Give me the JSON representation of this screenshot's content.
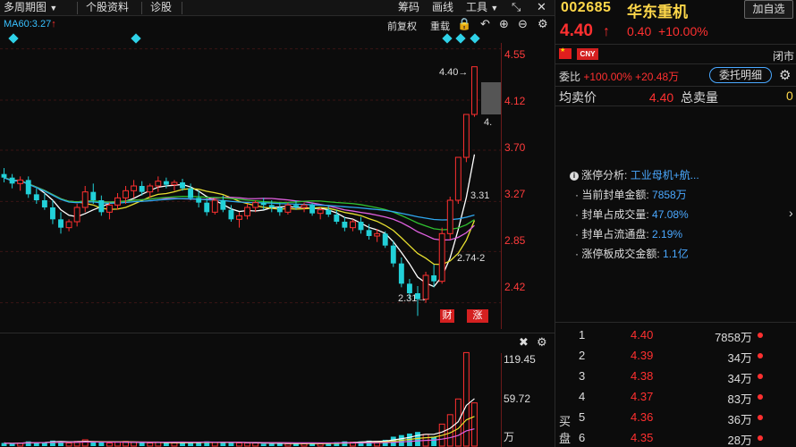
{
  "toolbar": {
    "period_label": "多周期图",
    "stock_info_label": "个股资料",
    "diagnose_label": "诊股",
    "chips_label": "筹码",
    "drawing_label": "画线",
    "tools_label": "工具"
  },
  "ma": {
    "label": "MA60:3.27",
    "arrow": "↑"
  },
  "chart_controls": {
    "forward_adj_label": "前复权",
    "overlay_label": "重载"
  },
  "price_axis": [
    "4.55",
    "4.12",
    "3.70",
    "3.27",
    "2.85",
    "2.42"
  ],
  "annotations": {
    "high": "4.40→",
    "low": "2.31→",
    "ma_val": "3.31",
    "ma_val2": "2.74-2",
    "ma_val3": "4.",
    "badge_cai": "财",
    "badge_zhang": "涨"
  },
  "volume_axis": [
    "119.45",
    "59.72",
    "万"
  ],
  "right_panel": {
    "code": "002685",
    "name": "华东重机",
    "add_watch_label": "加自选",
    "price": "4.40",
    "arrow": "↑",
    "change": "0.40",
    "change_pct": "+10.00%",
    "currency_badge": "CNY",
    "status": "闭市",
    "weibi_label": "委比",
    "weibi_value": "+100.00%",
    "weicha_value": "+20.48万",
    "detail_button": "委托明细",
    "avg_label": "均卖价",
    "avg_value": "4.40",
    "total_label": "总卖量",
    "total_value": "0",
    "limit_up": {
      "title": "涨停分析:",
      "sector": "工业母机+航...",
      "rows": [
        {
          "label": "当前封单金额:",
          "value": "7858万"
        },
        {
          "label": "封单占成交量:",
          "value": "47.08%"
        },
        {
          "label": "封单占流通盘:",
          "value": "2.19%"
        },
        {
          "label": "涨停板成交金额:",
          "value": "1.1亿"
        }
      ]
    },
    "buy_label": "买盘",
    "order_book": [
      {
        "idx": "1",
        "price": "4.40",
        "vol": "7858万"
      },
      {
        "idx": "2",
        "price": "4.39",
        "vol": "34万"
      },
      {
        "idx": "3",
        "price": "4.38",
        "vol": "34万"
      },
      {
        "idx": "4",
        "price": "4.37",
        "vol": "83万"
      },
      {
        "idx": "5",
        "price": "4.36",
        "vol": "36万"
      },
      {
        "idx": "6",
        "price": "4.35",
        "vol": "28万"
      }
    ]
  },
  "colors": {
    "up": "#ff3030",
    "down": "#22d0d8",
    "ma5": "#ffffff",
    "ma10": "#e8e030",
    "ma20": "#e060e0",
    "ma30": "#30c030",
    "ma60": "#2fa8f0"
  },
  "chart_data": {
    "type": "candlestick",
    "ylim": [
      2.2,
      4.6
    ],
    "ohlc": [
      [
        3.5,
        3.55,
        3.43,
        3.47
      ],
      [
        3.47,
        3.5,
        3.38,
        3.42
      ],
      [
        3.42,
        3.48,
        3.36,
        3.45
      ],
      [
        3.45,
        3.48,
        3.3,
        3.33
      ],
      [
        3.33,
        3.38,
        3.25,
        3.28
      ],
      [
        3.28,
        3.34,
        3.2,
        3.22
      ],
      [
        3.22,
        3.28,
        3.08,
        3.12
      ],
      [
        3.12,
        3.18,
        3.0,
        3.05
      ],
      [
        3.05,
        3.12,
        3.02,
        3.1
      ],
      [
        3.1,
        3.25,
        3.06,
        3.22
      ],
      [
        3.22,
        3.4,
        3.18,
        3.35
      ],
      [
        3.35,
        3.42,
        3.25,
        3.28
      ],
      [
        3.28,
        3.32,
        3.15,
        3.18
      ],
      [
        3.18,
        3.26,
        3.12,
        3.24
      ],
      [
        3.24,
        3.34,
        3.2,
        3.3
      ],
      [
        3.3,
        3.4,
        3.25,
        3.36
      ],
      [
        3.36,
        3.45,
        3.3,
        3.4
      ],
      [
        3.4,
        3.44,
        3.32,
        3.35
      ],
      [
        3.35,
        3.42,
        3.3,
        3.4
      ],
      [
        3.4,
        3.48,
        3.35,
        3.44
      ],
      [
        3.44,
        3.47,
        3.38,
        3.41
      ],
      [
        3.41,
        3.45,
        3.36,
        3.43
      ],
      [
        3.43,
        3.46,
        3.36,
        3.38
      ],
      [
        3.38,
        3.42,
        3.28,
        3.3
      ],
      [
        3.3,
        3.36,
        3.22,
        3.26
      ],
      [
        3.26,
        3.3,
        3.15,
        3.18
      ],
      [
        3.18,
        3.3,
        3.16,
        3.28
      ],
      [
        3.28,
        3.32,
        3.18,
        3.2
      ],
      [
        3.2,
        3.24,
        3.1,
        3.12
      ],
      [
        3.12,
        3.18,
        3.05,
        3.15
      ],
      [
        3.15,
        3.25,
        3.12,
        3.22
      ],
      [
        3.22,
        3.28,
        3.18,
        3.26
      ],
      [
        3.26,
        3.3,
        3.2,
        3.24
      ],
      [
        3.24,
        3.28,
        3.18,
        3.22
      ],
      [
        3.22,
        3.26,
        3.15,
        3.18
      ],
      [
        3.18,
        3.26,
        3.16,
        3.24
      ],
      [
        3.24,
        3.28,
        3.2,
        3.22
      ],
      [
        3.22,
        3.26,
        3.18,
        3.24
      ],
      [
        3.24,
        3.26,
        3.15,
        3.17
      ],
      [
        3.17,
        3.22,
        3.12,
        3.2
      ],
      [
        3.2,
        3.24,
        3.14,
        3.16
      ],
      [
        3.16,
        3.2,
        3.08,
        3.1
      ],
      [
        3.1,
        3.14,
        3.02,
        3.05
      ],
      [
        3.05,
        3.12,
        3.02,
        3.1
      ],
      [
        3.1,
        3.14,
        3.0,
        3.03
      ],
      [
        3.03,
        3.08,
        2.95,
        2.98
      ],
      [
        2.98,
        3.04,
        2.93,
        3.0
      ],
      [
        3.0,
        3.02,
        2.88,
        2.9
      ],
      [
        2.9,
        2.94,
        2.72,
        2.75
      ],
      [
        2.75,
        2.8,
        2.55,
        2.58
      ],
      [
        2.58,
        2.62,
        2.45,
        2.5
      ],
      [
        2.5,
        2.56,
        2.31,
        2.45
      ],
      [
        2.45,
        2.68,
        2.42,
        2.65
      ],
      [
        2.65,
        2.74,
        2.55,
        2.6
      ],
      [
        2.6,
        3.05,
        2.58,
        3.0
      ],
      [
        3.0,
        3.31,
        2.95,
        3.28
      ],
      [
        3.28,
        3.64,
        3.25,
        3.64
      ],
      [
        3.64,
        4.0,
        3.6,
        4.0
      ],
      [
        4.0,
        4.4,
        3.98,
        4.4
      ]
    ],
    "volume": [
      4,
      3,
      4,
      6,
      5,
      5,
      7,
      6,
      4,
      6,
      8,
      5,
      5,
      4,
      5,
      6,
      5,
      4,
      4,
      5,
      4,
      4,
      4,
      5,
      5,
      6,
      5,
      4,
      5,
      4,
      4,
      4,
      3,
      3,
      4,
      3,
      3,
      3,
      4,
      3,
      4,
      5,
      6,
      5,
      6,
      7,
      6,
      8,
      12,
      14,
      16,
      18,
      15,
      12,
      28,
      40,
      60,
      119,
      55
    ],
    "ma_lines": [
      "ma5",
      "ma10",
      "ma20",
      "ma30",
      "ma60"
    ]
  }
}
